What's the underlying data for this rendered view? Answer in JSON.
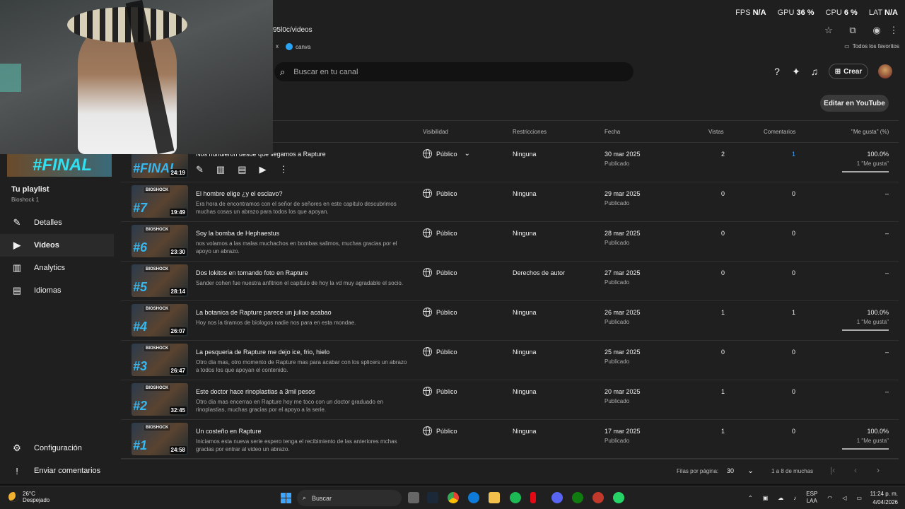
{
  "perf": {
    "fps_label": "FPS",
    "fps": "N/A",
    "gpu_label": "GPU",
    "gpu": "36 %",
    "cpu_label": "CPU",
    "cpu": "6 %",
    "lat_label": "LAT",
    "lat": "N/A"
  },
  "browser": {
    "url": "95l0c/videos",
    "bookmark_canva": "canva",
    "bookmark_close": "x",
    "favorites": "Todos los favoritos"
  },
  "header": {
    "search_placeholder": "Buscar en tu canal",
    "create_label": "Crear"
  },
  "sidebar": {
    "playlist_thumb_text": "#FINAL",
    "playlist_title": "Tu playlist",
    "playlist_sub": "Bioshock 1",
    "items": [
      {
        "label": "Detalles",
        "icon": "pencil-icon"
      },
      {
        "label": "Videos",
        "icon": "video-icon"
      },
      {
        "label": "Analytics",
        "icon": "chart-icon"
      },
      {
        "label": "Idiomas",
        "icon": "subtitles-icon"
      }
    ],
    "settings_label": "Configuración",
    "feedback_label": "Enviar comentarios"
  },
  "main": {
    "edit_youtube": "Editar en YouTube",
    "columns": {
      "visibility": "Visibilidad",
      "restrictions": "Restricciones",
      "date": "Fecha",
      "views": "Vistas",
      "comments": "Comentarios",
      "likes": "\"Me gusta\" (%)"
    },
    "rows": [
      {
        "num": "#FINAL",
        "duration": "24:19",
        "title": "Nos hundieron desde que llegamos a Rapture",
        "desc": "",
        "visibility": "Público",
        "restrictions": "Ninguna",
        "date": "30 mar 2025",
        "status": "Publicado",
        "views": "2",
        "comments": "1",
        "likes": "100.0%",
        "likes_sub": "1 \"Me gusta\""
      },
      {
        "num": "#7",
        "duration": "19:49",
        "title": "El hombre elige ¿y el esclavo?",
        "desc": "Era hora de encontramos con el señor de señores en este capitulo descubrimos muchas cosas un abrazo para todos los que apoyan.",
        "visibility": "Público",
        "restrictions": "Ninguna",
        "date": "29 mar 2025",
        "status": "Publicado",
        "views": "0",
        "comments": "0",
        "likes": "–",
        "likes_sub": ""
      },
      {
        "num": "#6",
        "duration": "23:30",
        "title": "Soy la bomba de Hephaestus",
        "desc": "nos volamos a las malas muchachos en bombas salimos, muchas gracias por el apoyo un abrazo.",
        "visibility": "Público",
        "restrictions": "Ninguna",
        "date": "28 mar 2025",
        "status": "Publicado",
        "views": "0",
        "comments": "0",
        "likes": "–",
        "likes_sub": ""
      },
      {
        "num": "#5",
        "duration": "28:14",
        "title": "Dos lokitos en tomando foto en Rapture",
        "desc": "Sander cohen fue nuestra anfitrion el capitulo de hoy la vd muy agradable el socio.",
        "visibility": "Público",
        "restrictions": "Derechos de autor",
        "date": "27 mar 2025",
        "status": "Publicado",
        "views": "0",
        "comments": "0",
        "likes": "–",
        "likes_sub": ""
      },
      {
        "num": "#4",
        "duration": "26:07",
        "title": "La botanica de Rapture parece un juliao acabao",
        "desc": "Hoy nos la tiramos de biologos nadie nos para en esta mondae.",
        "visibility": "Público",
        "restrictions": "Ninguna",
        "date": "26 mar 2025",
        "status": "Publicado",
        "views": "1",
        "comments": "1",
        "likes": "100.0%",
        "likes_sub": "1 \"Me gusta\""
      },
      {
        "num": "#3",
        "duration": "26:47",
        "title": "La pesqueria de Rapture me dejo ice, frio, hielo",
        "desc": "Otro dia mas, otro momento de Rapture mas para acabar con los splicers un abrazo a todos los que apoyan el contenido.",
        "visibility": "Público",
        "restrictions": "Ninguna",
        "date": "25 mar 2025",
        "status": "Publicado",
        "views": "0",
        "comments": "0",
        "likes": "–",
        "likes_sub": ""
      },
      {
        "num": "#2",
        "duration": "32:45",
        "title": "Este doctor hace rinoplastias a 3mil pesos",
        "desc": "Otro dia mas encerrao en Rapture hoy me toco con un doctor graduado en rinoplastias, muchas gracias por el apoyo a la serie.",
        "visibility": "Público",
        "restrictions": "Ninguna",
        "date": "20 mar 2025",
        "status": "Publicado",
        "views": "1",
        "comments": "0",
        "likes": "–",
        "likes_sub": ""
      },
      {
        "num": "#1",
        "duration": "24:58",
        "title": "Un costeño en Rapture",
        "desc": "Iniciamos esta nueva serie espero tenga el recibimiento de las anteriores mchas gracias por entrar al video un abrazo.",
        "visibility": "Público",
        "restrictions": "Ninguna",
        "date": "17 mar 2025",
        "status": "Publicado",
        "views": "1",
        "comments": "0",
        "likes": "100.0%",
        "likes_sub": "1 \"Me gusta\""
      }
    ],
    "pagination": {
      "rows_label": "Filas por página:",
      "rows_value": "30",
      "range": "1 a 8 de muchas"
    }
  },
  "taskbar": {
    "temp": "26°C",
    "weather": "Despejado",
    "search": "Buscar",
    "lang1": "ESP",
    "lang2": "LAA",
    "time": "11:24 p. m.",
    "date": "4/04/2026"
  }
}
